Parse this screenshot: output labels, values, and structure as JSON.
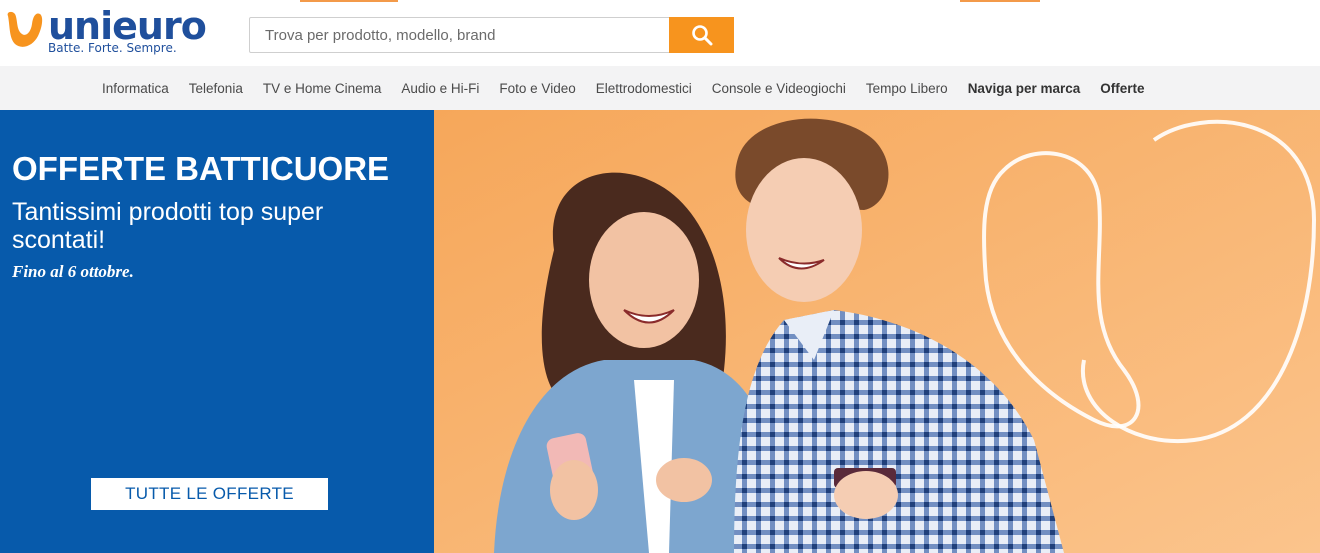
{
  "header": {
    "logo": {
      "wordmark": "unieuro",
      "tagline": "Batte. Forte. Sempre."
    },
    "search": {
      "placeholder": "Trova per prodotto, modello, brand",
      "button_icon": "search-icon"
    }
  },
  "nav": {
    "items": [
      {
        "label": "Informatica",
        "bold": false
      },
      {
        "label": "Telefonia",
        "bold": false
      },
      {
        "label": "TV e Home Cinema",
        "bold": false
      },
      {
        "label": "Audio e Hi-Fi",
        "bold": false
      },
      {
        "label": "Foto e Video",
        "bold": false
      },
      {
        "label": "Elettrodomestici",
        "bold": false
      },
      {
        "label": "Console e Videogiochi",
        "bold": false
      },
      {
        "label": "Tempo Libero",
        "bold": false
      },
      {
        "label": "Naviga per marca",
        "bold": true
      },
      {
        "label": "Offerte",
        "bold": true
      }
    ]
  },
  "hero": {
    "title": "OFFERTE BATTICUORE",
    "subtitle": "Tantissimi prodotti top super scontati!",
    "date_note": "Fino al 6 ottobre.",
    "cta_label": "TUTTE LE OFFERTE",
    "image": "couple-looking-at-smartphone-photo"
  },
  "colors": {
    "brand_blue": "#075aab",
    "brand_orange": "#f7941e",
    "hero_orange_bg": "#f8b36c",
    "nav_bg": "#f3f3f4"
  }
}
